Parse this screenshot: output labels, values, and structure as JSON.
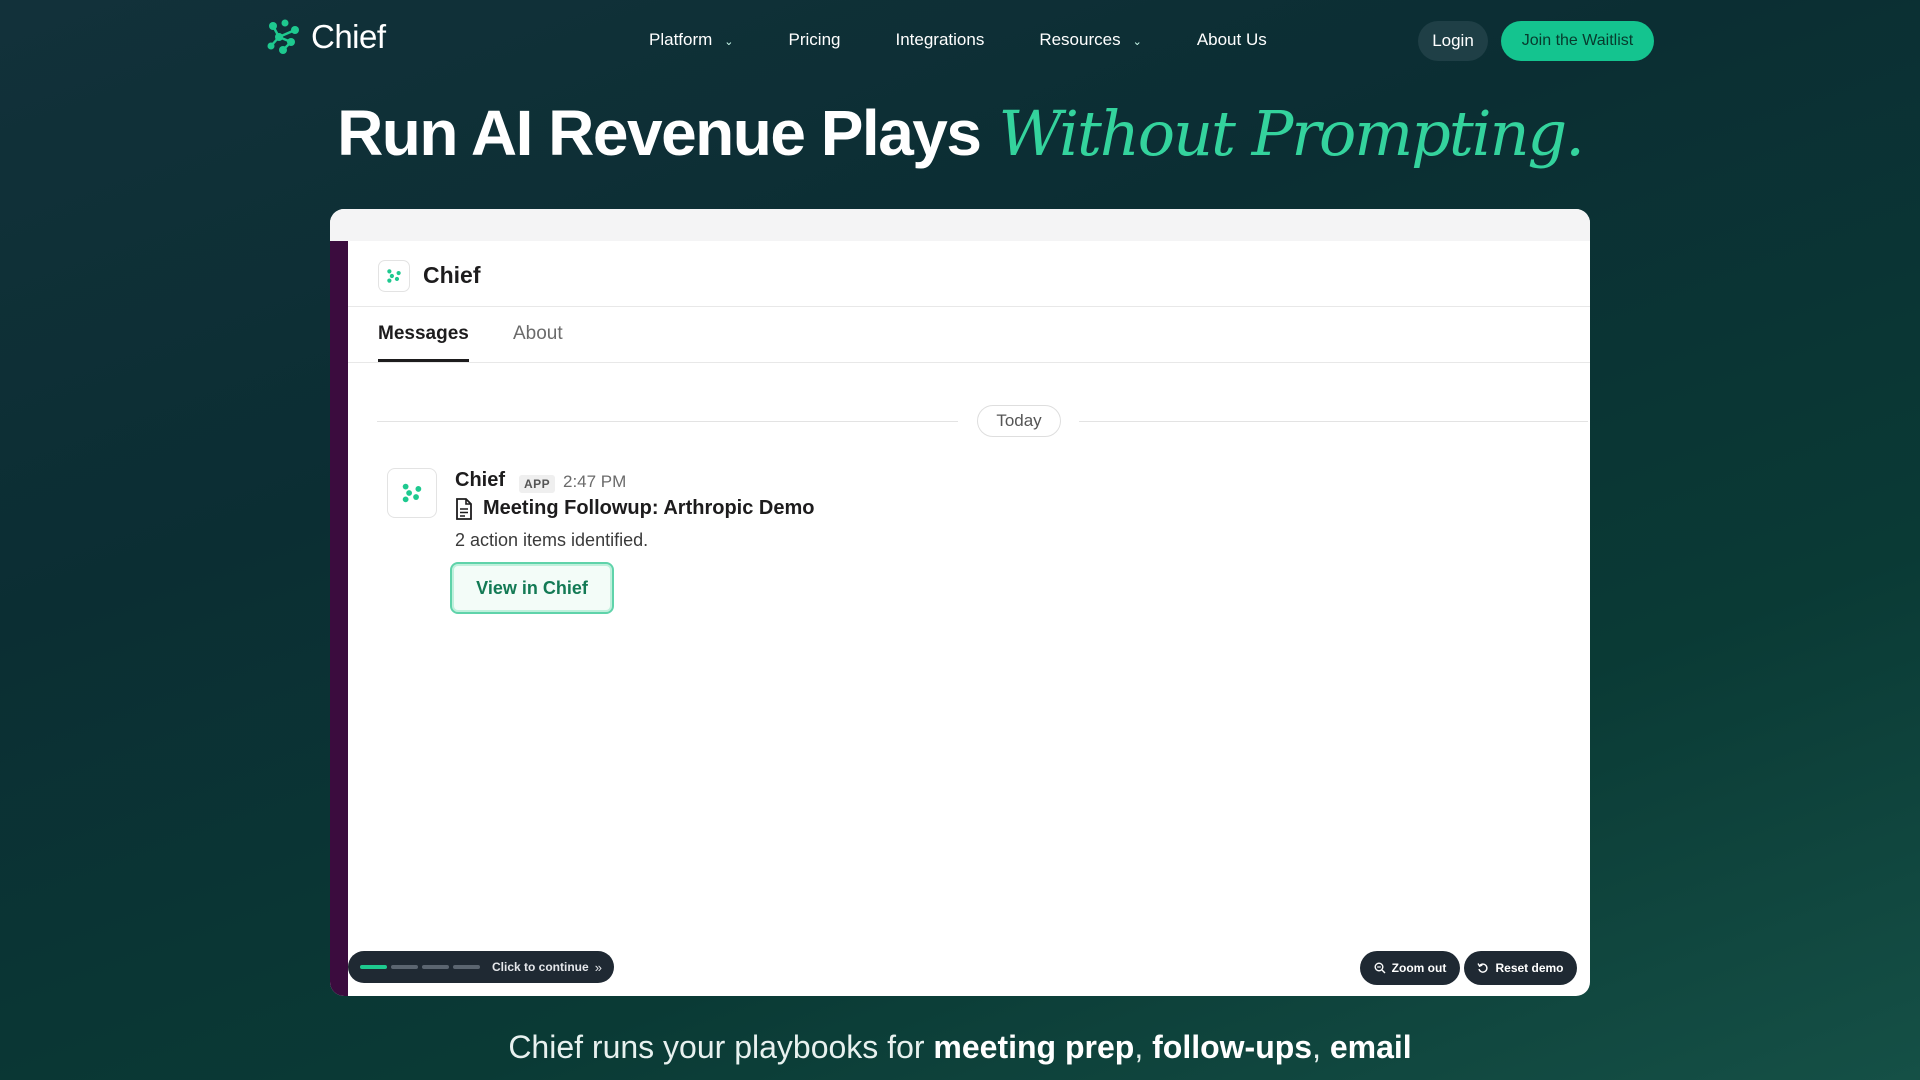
{
  "nav": {
    "logo_text": "Chief",
    "links": [
      {
        "label": "Platform",
        "dropdown": true
      },
      {
        "label": "Pricing",
        "dropdown": false
      },
      {
        "label": "Integrations",
        "dropdown": false
      },
      {
        "label": "Resources",
        "dropdown": true
      },
      {
        "label": "About Us",
        "dropdown": false
      }
    ],
    "login_label": "Login",
    "waitlist_label": "Join the Waitlist"
  },
  "hero": {
    "headline": "Run AI Revenue Plays",
    "accent": "Without Prompting."
  },
  "demo": {
    "app_name": "Chief",
    "tabs": [
      {
        "label": "Messages",
        "active": true
      },
      {
        "label": "About",
        "active": false
      }
    ],
    "date_label": "Today",
    "message": {
      "author": "Chief",
      "badge": "APP",
      "time": "2:47 PM",
      "title": "Meeting Followup: Arthropic Demo",
      "body": "2 action items identified.",
      "button_label": "View in Chief"
    },
    "progress": {
      "segments": 4,
      "current": 1,
      "continue_label": "Click to continue"
    },
    "zoom_label": "Zoom out",
    "reset_label": "Reset demo"
  },
  "subtext": {
    "prefix": "Chief runs your playbooks for ",
    "bold1": "meeting prep",
    "sep1": ", ",
    "bold2": "follow-ups",
    "sep2": ", ",
    "bold3": "email"
  },
  "colors": {
    "accent": "#14c48f",
    "accent_text": "#34d39d",
    "sidebar": "#3b0c3e",
    "pill_bg": "#1f2933"
  }
}
